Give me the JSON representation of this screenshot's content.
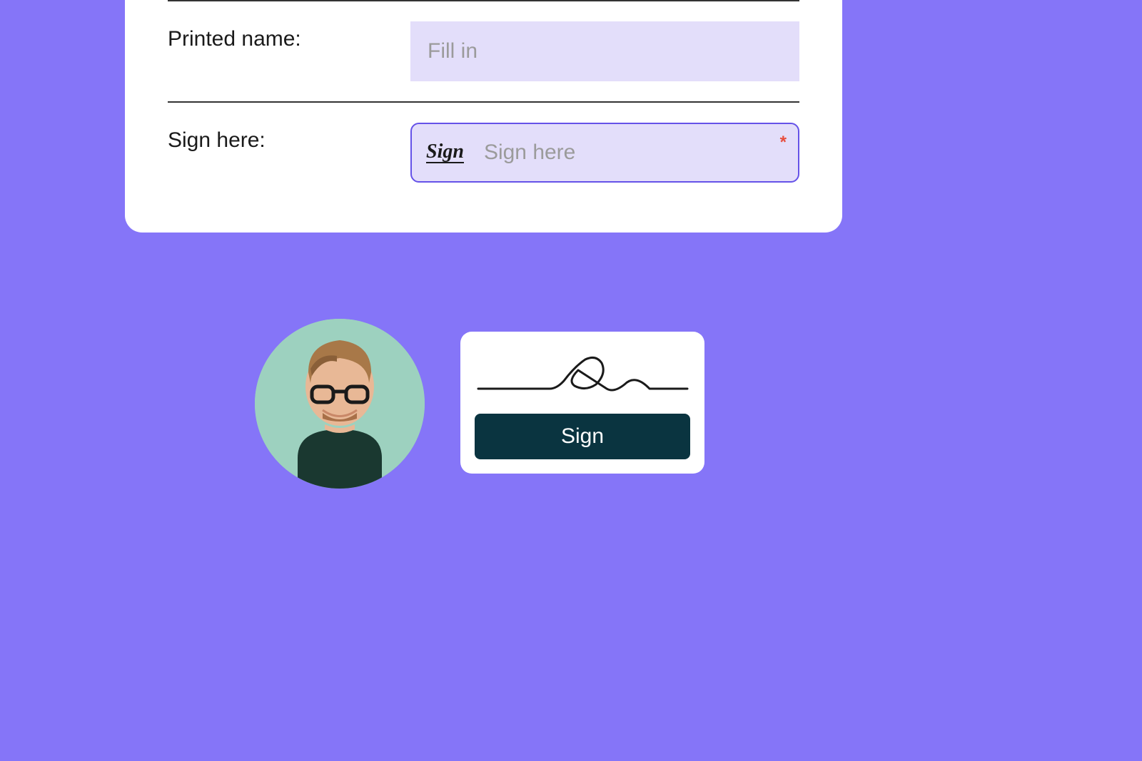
{
  "form": {
    "printed_name": {
      "label": "Printed name:",
      "placeholder": "Fill in"
    },
    "sign_here": {
      "label": "Sign here:",
      "icon_text": "Sign",
      "placeholder": "Sign here",
      "required_marker": "*"
    }
  },
  "signature_card": {
    "button_label": "Sign"
  }
}
